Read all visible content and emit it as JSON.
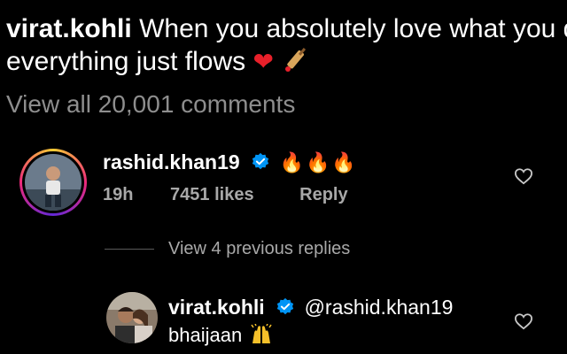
{
  "caption": {
    "username": "virat.kohli",
    "text_line1": "When you absolutely love what you do",
    "text_line2": "everything just flows",
    "emojis": [
      "red-heart",
      "cricket-bat"
    ]
  },
  "view_all_comments": "View all 20,001 comments",
  "comment": {
    "username": "rashid.khan19",
    "verified": true,
    "text": "🔥🔥🔥",
    "time": "19h",
    "likes": "7451 likes",
    "reply_label": "Reply"
  },
  "view_previous_replies": "View 4 previous replies",
  "reply": {
    "username": "virat.kohli",
    "verified": true,
    "mention": "@rashid.khan19",
    "text": "bhaijaan",
    "emoji": "raised-hands"
  },
  "colors": {
    "background": "#000000",
    "text_primary": "#ffffff",
    "text_secondary": "#a8a8a8",
    "verified_blue": "#0095f6",
    "heart_red": "#e8202a"
  }
}
